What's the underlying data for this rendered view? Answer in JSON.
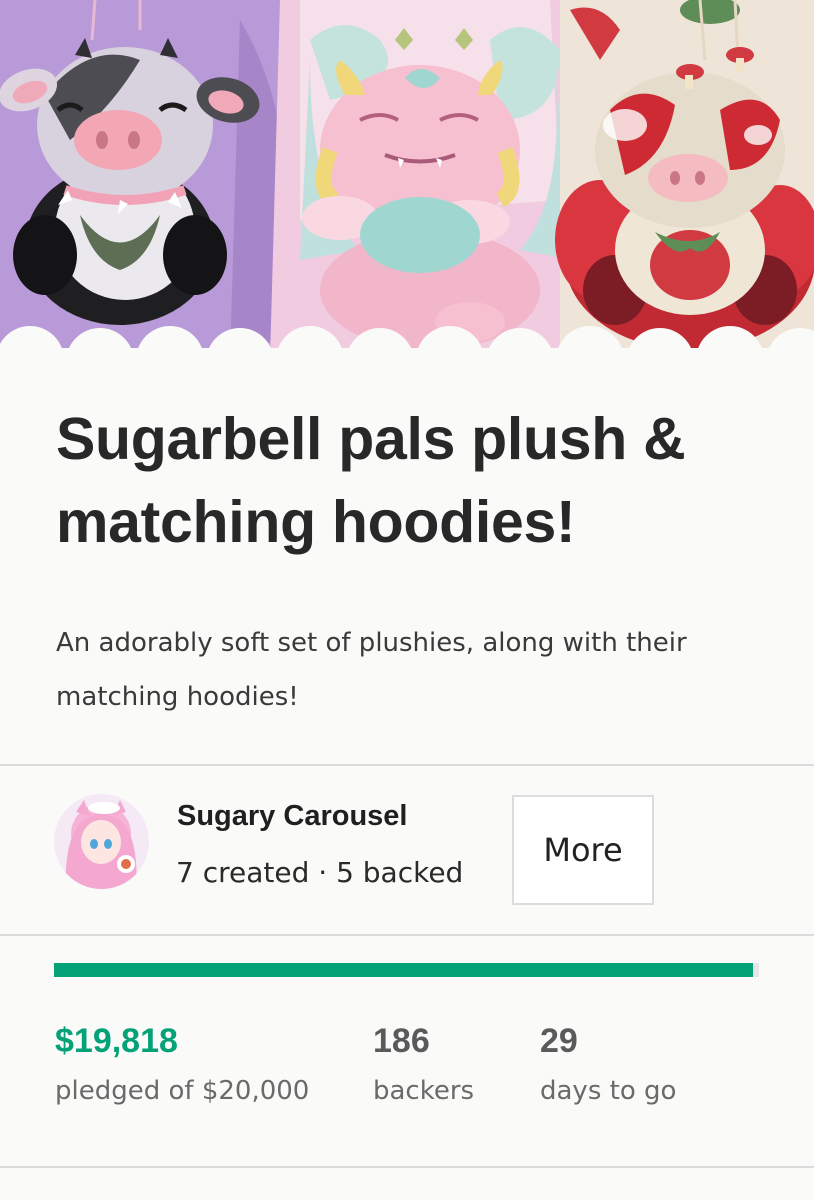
{
  "project": {
    "title": "Sugarbell pals plush & matching hoodies!",
    "blurb": "An adorably soft set of plushies, along with their matching hoodies!"
  },
  "creator": {
    "name": "Sugary Carousel",
    "stats": "7 created · 5 backed",
    "more_label": "More"
  },
  "funding": {
    "progress_fraction": 0.991,
    "progress_color": "#05a278",
    "pledged": "$19,818",
    "pledged_label": "pledged of $20,000",
    "backers": "186",
    "backers_label": "backers",
    "days": "29",
    "days_label": "days to go"
  },
  "colors": {
    "accent": "#05a278",
    "background": "#fafaf8",
    "divider": "#dcdcdc"
  }
}
